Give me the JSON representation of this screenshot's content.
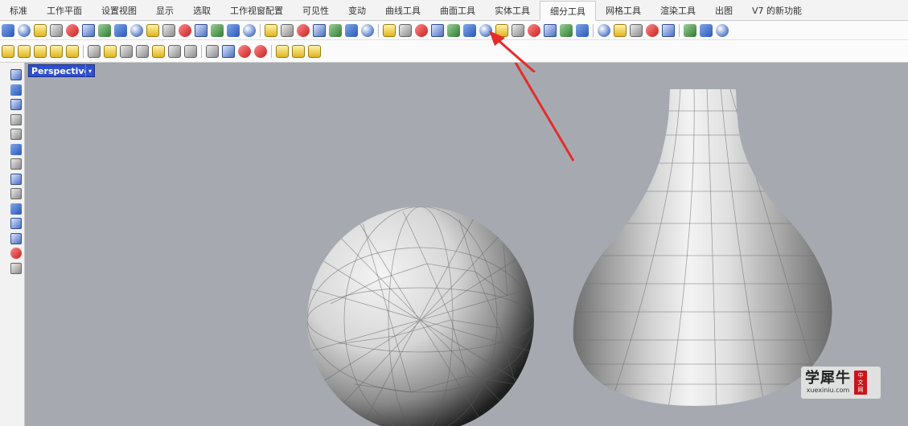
{
  "tabs": [
    {
      "label": "标准",
      "active": false
    },
    {
      "label": "工作平面",
      "active": false
    },
    {
      "label": "设置视图",
      "active": false
    },
    {
      "label": "显示",
      "active": false
    },
    {
      "label": "选取",
      "active": false
    },
    {
      "label": "工作视窗配置",
      "active": false
    },
    {
      "label": "可见性",
      "active": false
    },
    {
      "label": "变动",
      "active": false
    },
    {
      "label": "曲线工具",
      "active": false
    },
    {
      "label": "曲面工具",
      "active": false
    },
    {
      "label": "实体工具",
      "active": false
    },
    {
      "label": "细分工具",
      "active": true
    },
    {
      "label": "网格工具",
      "active": false
    },
    {
      "label": "渲染工具",
      "active": false
    },
    {
      "label": "出图",
      "active": false
    },
    {
      "label": "V7 的新功能",
      "active": false
    }
  ],
  "viewport": {
    "label": "Perspective",
    "dropdown_glyph": "▾"
  },
  "watermark": {
    "title": "学犀牛",
    "url": "xuexiniu.com",
    "badge": [
      "中",
      "文",
      "网"
    ]
  },
  "colors": {
    "viewport_bg": "#a6aab0",
    "viewport_label_bg": "#2f4fd1",
    "arrow": "#e52c2c",
    "active_tab_bg": "#fbfbfb"
  },
  "toolbar_row1_icons": [
    "subd-box-icon",
    "subd-sphere-icon",
    "subd-cylinder-icon",
    "subd-cone-icon",
    "subd-torus-icon",
    "subd-ellipsoid-icon",
    "subd-disc-icon",
    "subd-tube-icon",
    "subd-pipe-icon",
    "subd-loft-icon",
    "subd-sweep-icon",
    "subd-revolve-icon",
    "subd-patch-icon",
    "subd-extrude-icon",
    "subd-fill-icon",
    "subd-bridge-icon",
    "subd-append-icon",
    "subd-bevel-icon",
    "subd-crease-icon",
    "subd-uncrease-icon",
    "subd-insert-edge-icon",
    "subd-slide-icon",
    "subd-stitch-icon",
    "subd-weld-icon",
    "subd-unweld-icon",
    "subd-offset-icon",
    "subd-thicken-icon",
    "subd-smooth-icon",
    "subd-polygon-view-icon",
    "subd-box-mode-icon",
    "subd-to-mesh-icon",
    "subd-to-nurbs-icon",
    "subd-merge-icon",
    "subd-align-icon",
    "subd-symmetry-icon",
    "subd-select-icon",
    "subd-display-icon",
    "subd-paint-icon",
    "subd-list-icon",
    "subd-repair-icon",
    "subd-check-icon",
    "subd-settings-icon",
    "subd-delete-icon",
    "subd-close-icon"
  ],
  "toolbar_row2_icons": [
    "light-icon",
    "light-bulb-icon",
    "light-spot-icon",
    "light-point-icon",
    "light-ambient-icon",
    "page-icon",
    "page-light-icon",
    "lock-icon",
    "lock-small-icon",
    "unlock-icon",
    "lock-toggle-icon",
    "lock-display-icon",
    "grid-icon",
    "array-icon",
    "trim-icon",
    "close-red-icon",
    "light-shade-icon",
    "light-warm-icon",
    "light-cool-icon"
  ],
  "left_tools": [
    "eraser-icon",
    "grid-box-icon",
    "lock-blue-icon",
    "cylinder-icon",
    "bend-icon",
    "slice-icon",
    "path-icon",
    "flag-icon",
    "mesh-icon",
    "morph-icon",
    "scatter-icon",
    "loop-icon",
    "stamp-icon",
    "lock-grey-icon"
  ]
}
